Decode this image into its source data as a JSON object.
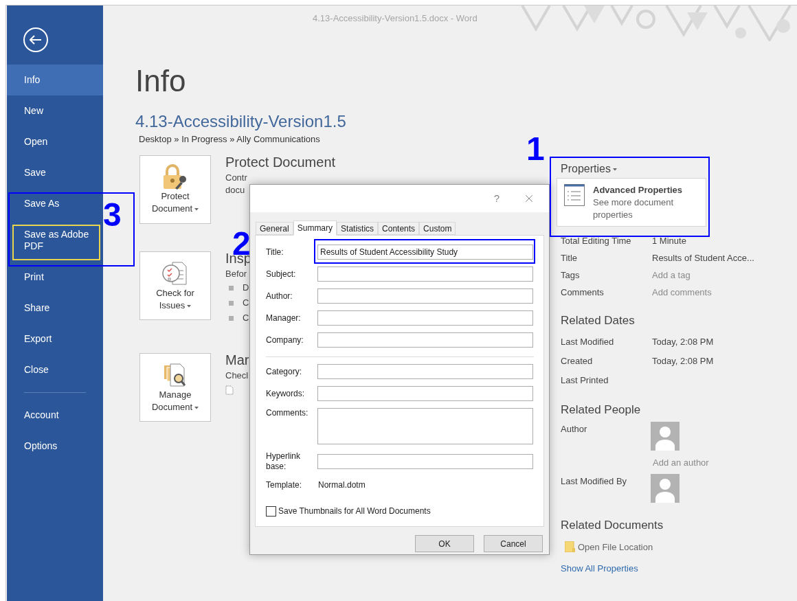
{
  "window": {
    "title": "4.13-Accessibility-Version1.5.docx - Word"
  },
  "sidebar": {
    "items": [
      {
        "label": "Info",
        "selected": true
      },
      {
        "label": "New",
        "selected": false
      },
      {
        "label": "Open",
        "selected": false
      },
      {
        "label": "Save",
        "selected": false
      },
      {
        "label": "Save As",
        "selected": false
      },
      {
        "label": "Save as Adobe PDF",
        "selected": false
      },
      {
        "label": "Print",
        "selected": false
      },
      {
        "label": "Share",
        "selected": false
      },
      {
        "label": "Export",
        "selected": false
      },
      {
        "label": "Close",
        "selected": false
      }
    ],
    "bottom_items": [
      {
        "label": "Account",
        "selected": false
      },
      {
        "label": "Options",
        "selected": false
      }
    ]
  },
  "page": {
    "heading": "Info",
    "document_title": "4.13-Accessibility-Version1.5",
    "breadcrumb": "Desktop » In Progress » Ally Communications"
  },
  "sections": [
    {
      "kind": "protect",
      "button_lines": [
        "Protect",
        "Document"
      ],
      "heading": "Protect Document",
      "description_lines": [
        "Contr",
        "docu"
      ]
    },
    {
      "kind": "inspect",
      "button_lines": [
        "Check for",
        "Issues"
      ],
      "heading": "Insp",
      "description_lines": [
        "Befor"
      ],
      "bullets": [
        "D",
        "C",
        "C"
      ]
    },
    {
      "kind": "manage",
      "button_lines": [
        "Manage",
        "Document"
      ],
      "heading": "Mar",
      "description_lines": [
        "Checl"
      ]
    }
  ],
  "properties": {
    "heading": "Properties",
    "menu": {
      "title": "Advanced Properties",
      "description": "See more document properties"
    },
    "rows": [
      {
        "label": "Total Editing Time",
        "value": "1 Minute",
        "kind": "value"
      },
      {
        "label": "Title",
        "value": "Results of Student Acce...",
        "kind": "value"
      },
      {
        "label": "Tags",
        "value": "Add a tag",
        "kind": "hint"
      },
      {
        "label": "Comments",
        "value": "Add comments",
        "kind": "hint"
      }
    ]
  },
  "related_dates": {
    "heading": "Related Dates",
    "rows": [
      {
        "label": "Last Modified",
        "value": "Today, 2:08 PM"
      },
      {
        "label": "Created",
        "value": "Today, 2:08 PM"
      },
      {
        "label": "Last Printed"
      }
    ]
  },
  "related_people": {
    "heading": "Related People",
    "rows": [
      {
        "label": "Author",
        "action": "Add an author"
      },
      {
        "label": "Last Modified By"
      }
    ]
  },
  "related_documents": {
    "heading": "Related Documents",
    "link": "Open File Location",
    "show_all": "Show All Properties"
  },
  "dialog": {
    "help": "?",
    "tabs": [
      {
        "label": "General",
        "selected": false
      },
      {
        "label": "Summary",
        "selected": true
      },
      {
        "label": "Statistics",
        "selected": false
      },
      {
        "label": "Contents",
        "selected": false
      },
      {
        "label": "Custom",
        "selected": false
      }
    ],
    "field_groups": [
      [
        {
          "label": "Title:",
          "value": "Results of Student Accessibility Study",
          "kind": "text"
        },
        {
          "label": "Subject:",
          "kind": "text"
        },
        {
          "label": "Author:",
          "kind": "text"
        },
        {
          "label": "Manager:",
          "kind": "text"
        },
        {
          "label": "Company:",
          "kind": "text"
        }
      ],
      [
        {
          "label": "Category:",
          "kind": "text"
        },
        {
          "label": "Keywords:",
          "kind": "text"
        },
        {
          "label": "Comments:",
          "kind": "textarea"
        },
        {
          "label": "Hyperlink base:",
          "kind": "text"
        },
        {
          "label": "Template:",
          "value": "Normal.dotm",
          "kind": "static"
        }
      ]
    ],
    "checkbox": {
      "label": "Save Thumbnails for All Word Documents",
      "checked": false
    },
    "buttons": [
      "OK",
      "Cancel"
    ]
  },
  "annotations": [
    {
      "label": "1",
      "kind": "properties"
    },
    {
      "label": "2",
      "kind": "title_field"
    },
    {
      "label": "3",
      "kind": "save_as"
    }
  ]
}
